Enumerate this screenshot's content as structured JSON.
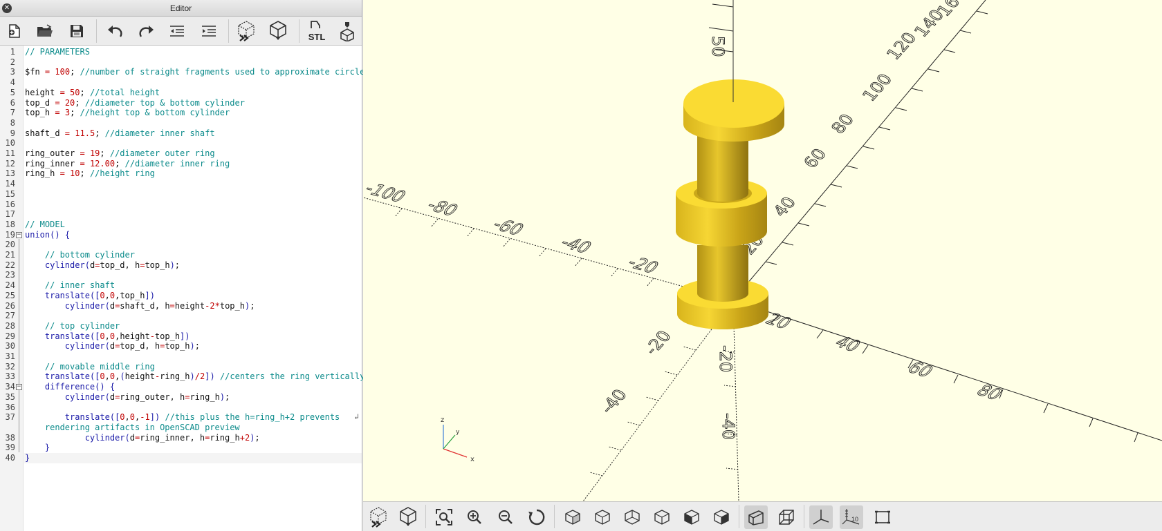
{
  "editor": {
    "title": "Editor",
    "toolbar": [
      {
        "name": "new-file-icon"
      },
      {
        "name": "open-folder-icon"
      },
      {
        "name": "save-icon"
      },
      {
        "name": "undo-icon"
      },
      {
        "name": "redo-icon"
      },
      {
        "name": "unindent-icon"
      },
      {
        "name": "indent-icon"
      },
      {
        "name": "preview-icon"
      },
      {
        "name": "render-icon"
      },
      {
        "name": "export-stl-icon",
        "label": "STL"
      },
      {
        "name": "send-to-3d-print-icon"
      }
    ],
    "stl_label": "STL",
    "code": [
      "// PARAMETERS",
      "",
      "$fn = 100; //number of straight fragments used to approximate circle",
      "",
      "height = 50; //total height",
      "top_d = 20; //diameter top & bottom cylinder",
      "top_h = 3; //height top & bottom cylinder",
      "",
      "shaft_d = 11.5; //diameter inner shaft",
      "",
      "ring_outer = 19; //diameter outer ring",
      "ring_inner = 12.00; //diameter inner ring",
      "ring_h = 10; //height ring",
      "",
      "",
      "",
      "",
      "// MODEL",
      "union() {",
      "",
      "    // bottom cylinder",
      "    cylinder(d=top_d, h=top_h);",
      "",
      "    // inner shaft",
      "    translate([0,0,top_h])",
      "        cylinder(d=shaft_d, h=height-2*top_h);",
      "",
      "    // top cylinder",
      "    translate([0,0,height-top_h])",
      "        cylinder(d=top_d, h=top_h);",
      "",
      "    // movable middle ring",
      "    translate([0,0,(height-ring_h)/2]) //centers the ring vertically",
      "    difference() {",
      "        cylinder(d=ring_outer, h=ring_h);",
      "",
      "        translate([0,0,-1]) //this plus the h=ring_h+2 prevents",
      "    rendering artifacts in OpenSCAD preview",
      "            cylinder(d=ring_inner, h=ring_h+2);",
      "    }",
      "}"
    ],
    "line_numbers": [
      "1",
      "2",
      "3",
      "4",
      "5",
      "6",
      "7",
      "8",
      "9",
      "10",
      "11",
      "12",
      "13",
      "14",
      "15",
      "16",
      "17",
      "18",
      "19",
      "20",
      "21",
      "22",
      "23",
      "24",
      "25",
      "26",
      "27",
      "28",
      "29",
      "30",
      "31",
      "32",
      "33",
      "34",
      "35",
      "36",
      "37",
      "",
      "38",
      "39",
      "40"
    ]
  },
  "viewport": {
    "background": "#ffffe6",
    "model_color": "#f9d72f",
    "axis_ticks": {
      "x_negative": [
        "-100",
        "-80",
        "-60",
        "-40",
        "-20"
      ],
      "x_positive": [
        "20",
        "40",
        "60",
        "80"
      ],
      "y_positive": [
        "20",
        "40",
        "60",
        "80",
        "100",
        "120",
        "140",
        "160"
      ],
      "y_negative": [
        "-20",
        "-40"
      ],
      "z_positive": [
        "50"
      ],
      "z_negative": [
        "-20",
        "-40"
      ]
    },
    "mini_axes": {
      "x": "x",
      "y": "y",
      "z": "z"
    }
  },
  "view_toolbar": [
    {
      "name": "preview-icon"
    },
    {
      "name": "render-icon"
    },
    {
      "name": "view-all-icon"
    },
    {
      "name": "zoom-in-icon"
    },
    {
      "name": "zoom-out-icon"
    },
    {
      "name": "reset-view-icon"
    },
    {
      "name": "view-right-icon"
    },
    {
      "name": "view-top-icon"
    },
    {
      "name": "view-bottom-icon"
    },
    {
      "name": "view-left-icon"
    },
    {
      "name": "view-front-icon"
    },
    {
      "name": "view-back-icon"
    },
    {
      "name": "perspective-icon",
      "active": true
    },
    {
      "name": "orthogonal-icon"
    },
    {
      "name": "show-axes-icon",
      "active": true
    },
    {
      "name": "show-scale-markers-icon",
      "active": true,
      "label": "10"
    },
    {
      "name": "show-edges-icon"
    }
  ],
  "scale_label": "10"
}
